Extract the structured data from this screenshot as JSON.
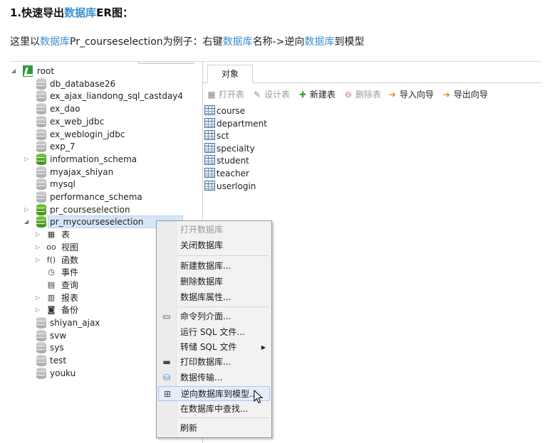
{
  "article": {
    "heading_prefix": "1.快速导出",
    "heading_highlight": "数据库",
    "heading_suffix": "ER图：",
    "intro": [
      {
        "text": "这里以",
        "hl": false
      },
      {
        "text": "数据库",
        "hl": true
      },
      {
        "text": "Pr_courseselection为例子：右键",
        "hl": false
      },
      {
        "text": "数据库",
        "hl": true
      },
      {
        "text": "名称->逆向",
        "hl": false
      },
      {
        "text": "数据库",
        "hl": true
      },
      {
        "text": "到模型",
        "hl": false
      }
    ]
  },
  "tree": {
    "root": "root",
    "databases": [
      {
        "label": "db_database26",
        "icon": "db-gray",
        "arrow": ""
      },
      {
        "label": "ex_ajax_liandong_sql_castday4",
        "icon": "db-gray",
        "arrow": ""
      },
      {
        "label": "ex_dao",
        "icon": "db-gray",
        "arrow": ""
      },
      {
        "label": "ex_web_jdbc",
        "icon": "db-gray",
        "arrow": ""
      },
      {
        "label": "ex_weblogin_jdbc",
        "icon": "db-gray",
        "arrow": ""
      },
      {
        "label": "exp_7",
        "icon": "db-gray",
        "arrow": ""
      },
      {
        "label": "information_schema",
        "icon": "db-green",
        "arrow": "▷"
      },
      {
        "label": "myajax_shiyan",
        "icon": "db-gray",
        "arrow": ""
      },
      {
        "label": "mysql",
        "icon": "db-gray",
        "arrow": ""
      },
      {
        "label": "performance_schema",
        "icon": "db-gray",
        "arrow": ""
      },
      {
        "label": "pr_courseselection",
        "icon": "db-green",
        "arrow": "▷"
      },
      {
        "label": "pr_mycourseselection",
        "icon": "db-green",
        "arrow": "◢"
      }
    ],
    "children": [
      {
        "label": "表",
        "icon": "▦",
        "arrow": "▷"
      },
      {
        "label": "视图",
        "icon": "oo",
        "arrow": "▷"
      },
      {
        "label": "函数",
        "icon": "f()",
        "arrow": "▷"
      },
      {
        "label": "事件",
        "icon": "◷",
        "arrow": ""
      },
      {
        "label": "查询",
        "icon": "▤",
        "arrow": ""
      },
      {
        "label": "报表",
        "icon": "▥",
        "arrow": "▷"
      },
      {
        "label": "备份",
        "icon": "◙",
        "arrow": "▷"
      }
    ],
    "more_databases": [
      "shiyan_ajax",
      "svw",
      "sys",
      "test",
      "youku"
    ]
  },
  "object_tab": "对象",
  "toolbar": [
    {
      "label": "打开表",
      "icon": "▦",
      "disabled": true
    },
    {
      "label": "设计表",
      "icon": "✎",
      "disabled": true
    },
    {
      "label": "新建表",
      "icon": "✚",
      "disabled": false
    },
    {
      "label": "删除表",
      "icon": "⊖",
      "disabled": true
    },
    {
      "label": "导入向导",
      "icon": "➜",
      "disabled": false
    },
    {
      "label": "导出向导",
      "icon": "➜",
      "disabled": false
    }
  ],
  "tables": [
    "course",
    "department",
    "sct",
    "specialty",
    "student",
    "teacher",
    "userlogin"
  ],
  "context_menu": {
    "items": [
      {
        "label": "打开数据库",
        "disabled": true,
        "icon": ""
      },
      {
        "label": "关闭数据库",
        "disabled": false,
        "icon": ""
      },
      {
        "label": "新建数据库...",
        "disabled": false,
        "icon": ""
      },
      {
        "label": "删除数据库",
        "disabled": false,
        "icon": ""
      },
      {
        "label": "数据库属性...",
        "disabled": false,
        "icon": ""
      },
      {
        "label": "命令列介面...",
        "disabled": false,
        "icon": "▭"
      },
      {
        "label": "运行 SQL 文件...",
        "disabled": false,
        "icon": ""
      },
      {
        "label": "转储 SQL 文件",
        "disabled": false,
        "icon": "",
        "submenu": "▶"
      },
      {
        "label": "打印数据库...",
        "disabled": false,
        "icon": "▬"
      },
      {
        "label": "数据传输...",
        "disabled": false,
        "icon": "⛁"
      },
      {
        "label": "逆向数据库到模型...",
        "disabled": false,
        "icon": "⊞",
        "hover": true
      },
      {
        "label": "在数据库中查找...",
        "disabled": false,
        "icon": ""
      },
      {
        "label": "刷新",
        "disabled": false,
        "icon": ""
      }
    ]
  }
}
